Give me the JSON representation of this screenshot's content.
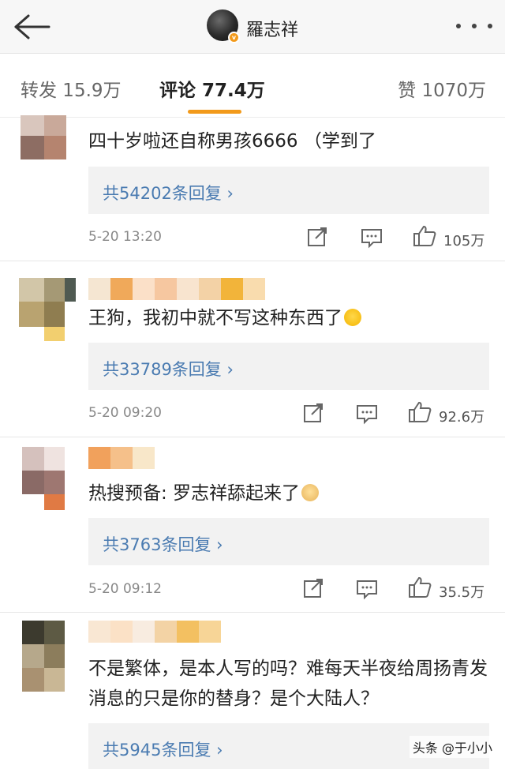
{
  "header": {
    "user_name": "羅志祥",
    "verified_badge": "v",
    "back_icon": "back-arrow-icon",
    "more_icon": "more-dots-icon"
  },
  "tabs": {
    "repost": "转发 15.9万",
    "comment": "评论 77.4万",
    "like": "赞 1070万",
    "active_color": "#f29a1b"
  },
  "comments": [
    {
      "text": "四十岁啦还自称男孩6666 （学到了",
      "replies": "共54202条回复 ",
      "time": "5-20 13:20",
      "likes": "105万"
    },
    {
      "text": "王狗，我初中就不写这种东西了",
      "emoji": "laughing-tears-emoji",
      "replies": "共33789条回复 ",
      "time": "5-20 09:20",
      "likes": "92.6万"
    },
    {
      "text": "热搜预备: 罗志祥舔起来了",
      "emoji": "dog-face-emoji",
      "replies": "共3763条回复 ",
      "time": "5-20 09:12",
      "likes": "35.5万"
    },
    {
      "text": "不是繁体，是本人写的吗？难每天半夜给周扬青发消息的只是你的替身？是个大陆人？",
      "replies": "共5945条回复 "
    }
  ],
  "reply_link_color": "#4a7bb1",
  "watermark": "头条 @于小小"
}
